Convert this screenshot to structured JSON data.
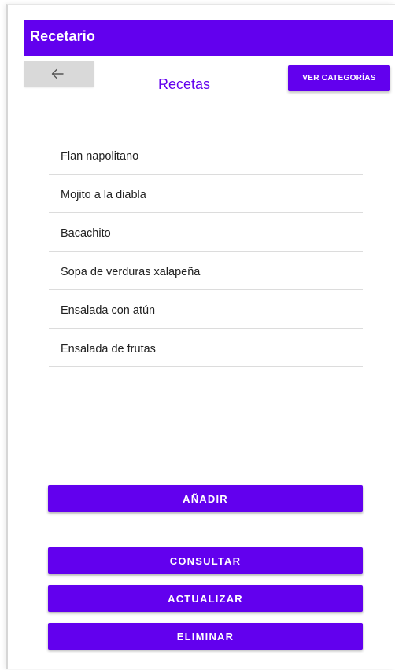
{
  "app": {
    "title": "Recetario",
    "accent_color": "#6200ee"
  },
  "header": {
    "back_icon": "arrow-left-icon",
    "screen_title": "Recetas",
    "categories_button": "VER CATEGORÍAS"
  },
  "recipes": [
    {
      "name": "Flan napolitano"
    },
    {
      "name": "Mojito a la diabla"
    },
    {
      "name": "Bacachito"
    },
    {
      "name": "Sopa de verduras xalapeña"
    },
    {
      "name": "Ensalada con atún"
    },
    {
      "name": "Ensalada de frutas"
    }
  ],
  "actions": {
    "add": "AÑADIR",
    "consult": "CONSULTAR",
    "update": "ACTUALIZAR",
    "delete": "ELIMINAR"
  }
}
